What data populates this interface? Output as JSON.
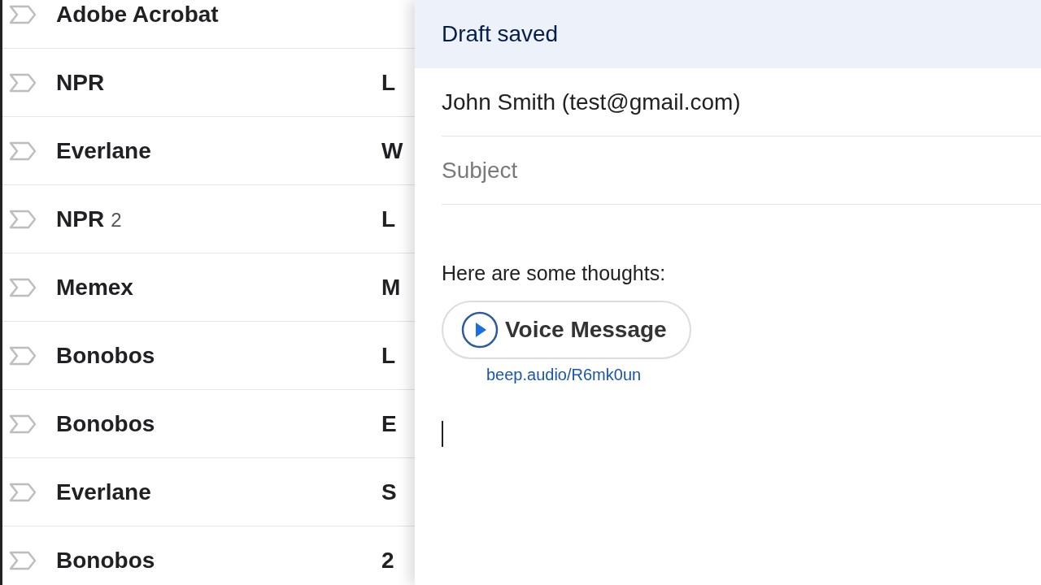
{
  "inbox": {
    "rows": [
      {
        "sender": "Adobe Acrobat",
        "snippet": ""
      },
      {
        "sender": "NPR",
        "snippet": "L"
      },
      {
        "sender": "Everlane",
        "snippet": "W"
      },
      {
        "sender": "NPR",
        "count": "2",
        "snippet": "L"
      },
      {
        "sender": "Memex",
        "snippet": "M"
      },
      {
        "sender": "Bonobos",
        "snippet": "L"
      },
      {
        "sender": "Bonobos",
        "snippet": "E"
      },
      {
        "sender": "Everlane",
        "snippet": "S"
      },
      {
        "sender": "Bonobos",
        "snippet": "2"
      }
    ]
  },
  "compose": {
    "title": "Draft saved",
    "to": "John Smith (test@gmail.com)",
    "subject_placeholder": "Subject",
    "body_text": "Here are some thoughts:",
    "voice_button": "Voice Message",
    "voice_link": "beep.audio/R6mk0un"
  }
}
